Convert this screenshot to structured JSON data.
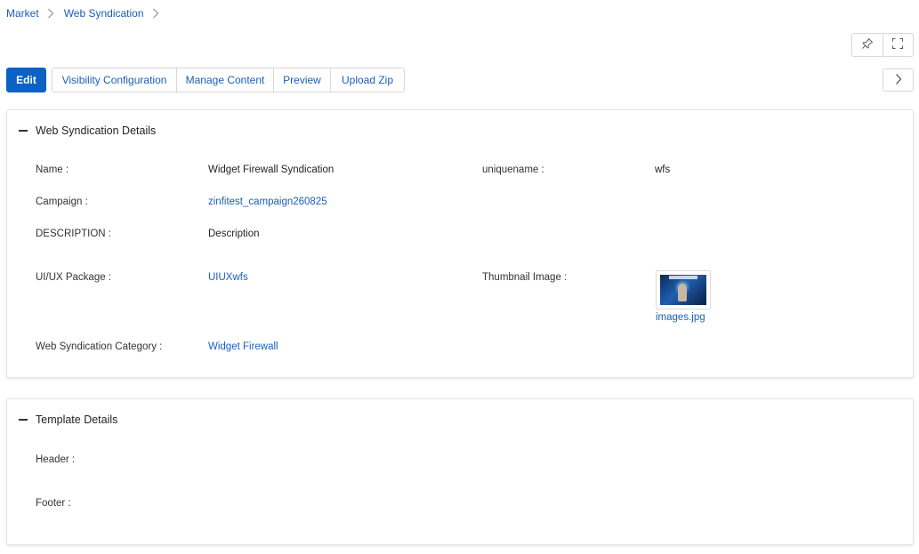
{
  "breadcrumb": {
    "items": [
      "Market",
      "Web Syndication"
    ]
  },
  "toolbar": {
    "pin_icon": "pin-icon",
    "fullscreen_icon": "fullscreen-icon"
  },
  "tabs": {
    "edit": "Edit",
    "visibility": "Visibility Configuration",
    "manage_content": "Manage Content",
    "preview": "Preview",
    "upload_zip": "Upload Zip"
  },
  "details": {
    "title": "Web Syndication Details",
    "name_label": "Name :",
    "name_value": "Widget Firewall Syndication",
    "uniquename_label": "uniquename :",
    "uniquename_value": "wfs",
    "campaign_label": "Campaign :",
    "campaign_value": "zinfitest_campaign260825",
    "description_label": "DESCRIPTION :",
    "description_value": "Description",
    "uiux_label": "UI/UX Package :",
    "uiux_value": "UIUXwfs",
    "thumbnail_label": "Thumbnail Image :",
    "thumbnail_file": "images.jpg",
    "category_label": "Web Syndication Category :",
    "category_value": "Widget Firewall"
  },
  "template": {
    "title": "Template Details",
    "header_label": "Header :",
    "footer_label": "Footer :"
  },
  "colors": {
    "accent": "#0b62c4",
    "link": "#1a5fb4",
    "border": "#d5d8dc"
  }
}
